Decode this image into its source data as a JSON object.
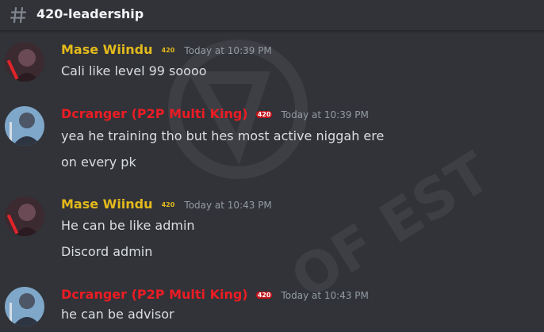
{
  "channel": {
    "name": "420-leadership",
    "icon": "hashtag-icon"
  },
  "watermark": {
    "text": "OF EST"
  },
  "messages": [
    {
      "author": "Mase Wiindu",
      "tag": "420",
      "timestamp": "Today at 10:39 PM",
      "lines": [
        "Cali like level 99 soooo"
      ]
    },
    {
      "author": "Dcranger (P2P Multi King)",
      "tag": "420",
      "timestamp": "Today at 10:39 PM",
      "lines": [
        "yea he training tho but hes most active niggah ere",
        "on  every pk"
      ]
    },
    {
      "author": "Mase Wiindu",
      "tag": "420",
      "timestamp": "Today at 10:43 PM",
      "lines": [
        "He can be like admin",
        "Discord admin"
      ]
    },
    {
      "author": "Dcranger (P2P Multi King)",
      "tag": "420",
      "timestamp": "Today at 10:43 PM",
      "lines": [
        "he can be advisor"
      ]
    }
  ],
  "colors": {
    "background": "#313338",
    "mase_name": "#e3b91c",
    "dcranger_name": "#ec1c24",
    "timestamp": "#949ba4",
    "text": "#dbdee1"
  }
}
